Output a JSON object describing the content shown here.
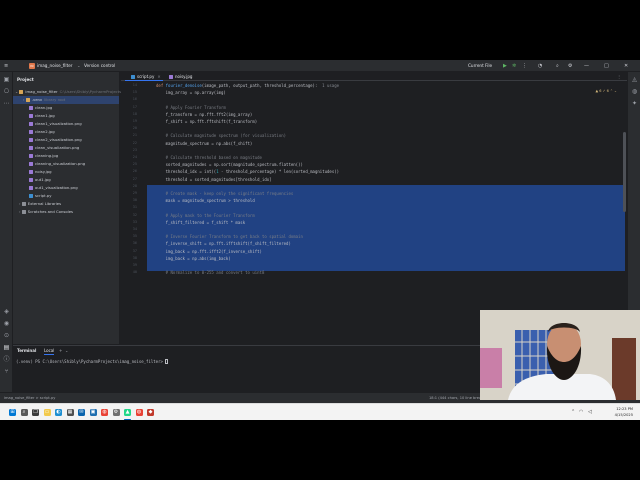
{
  "titlebar": {
    "project_badge": "IN",
    "project_name": "imag_noise_filter",
    "vcs": "Version control",
    "run_config": "Current File",
    "window_controls": [
      "—",
      "□",
      "✕"
    ]
  },
  "project_panel": {
    "header": "Project",
    "root_label": "imag_noise_filter",
    "root_path": "C:\\Users\\Shibly\\PycharmProjects\\imag_noise_filter",
    "items": [
      {
        "label": ".venv",
        "note": "library root",
        "kind": "folder"
      },
      {
        "label": "clean.jpg",
        "kind": "image"
      },
      {
        "label": "clean1.jpg",
        "kind": "image"
      },
      {
        "label": "clean1_visualization.png",
        "kind": "image"
      },
      {
        "label": "clean2.jpg",
        "kind": "image"
      },
      {
        "label": "clean2_visualization.png",
        "kind": "image"
      },
      {
        "label": "clean_visualization.png",
        "kind": "image"
      },
      {
        "label": "cleaning.jpg",
        "kind": "image"
      },
      {
        "label": "cleaning_visualization.png",
        "kind": "image"
      },
      {
        "label": "noisy.jpg",
        "kind": "image"
      },
      {
        "label": "out1.jpg",
        "kind": "image"
      },
      {
        "label": "out1_visualization.png",
        "kind": "image"
      },
      {
        "label": "script.py",
        "kind": "python"
      },
      {
        "label": "External Libraries",
        "kind": "library"
      },
      {
        "label": "Scratches and Consoles",
        "kind": "scratch"
      }
    ]
  },
  "editor": {
    "tabs": [
      {
        "label": "script.py",
        "active": true
      },
      {
        "label": "noisy.jpg",
        "active": false
      }
    ],
    "inspections": "▲ 6  ✓ 6  ⌃ ⌄",
    "line_numbers": [
      "14",
      "15",
      "16",
      "17",
      "18",
      "19",
      "20",
      "21",
      "22",
      "23",
      "24",
      "25",
      "26",
      "27",
      "28",
      "29",
      "30",
      "31",
      "32",
      "33",
      "34",
      "35",
      "36",
      "37",
      "38",
      "39",
      "40"
    ],
    "lines": [
      [
        {
          "t": "def ",
          "c": "kw"
        },
        {
          "t": "fourier_denoise",
          "c": "fn"
        },
        {
          "t": "(image_path, output_path, threshold_percentage):",
          "c": "tx"
        },
        {
          "t": "  1 usage",
          "c": "hint"
        }
      ],
      [
        {
          "t": "    img_array = np.array(img)",
          "c": "tx"
        }
      ],
      [
        {
          "t": "",
          "c": "tx"
        }
      ],
      [
        {
          "t": "    ",
          "c": "tx"
        },
        {
          "t": "# Apply Fourier Transform",
          "c": "cm"
        }
      ],
      [
        {
          "t": "    f_transform = np.fft.fft2(img_array)",
          "c": "tx"
        }
      ],
      [
        {
          "t": "    f_shift = np.fft.fftshift(f_transform)",
          "c": "tx"
        }
      ],
      [
        {
          "t": "",
          "c": "tx"
        }
      ],
      [
        {
          "t": "    ",
          "c": "tx"
        },
        {
          "t": "# Calculate magnitude spectrum (for visualization)",
          "c": "cm"
        }
      ],
      [
        {
          "t": "    magnitude_spectrum = np.abs(f_shift)",
          "c": "tx"
        }
      ],
      [
        {
          "t": "",
          "c": "tx"
        }
      ],
      [
        {
          "t": "    ",
          "c": "tx"
        },
        {
          "t": "# Calculate threshold based on magnitude",
          "c": "cm"
        }
      ],
      [
        {
          "t": "    sorted_magnitudes = np.sort(magnitude_spectrum.flatten())",
          "c": "tx"
        }
      ],
      [
        {
          "t": "    threshold_idx = int((",
          "c": "tx"
        },
        {
          "t": "1",
          "c": "nm"
        },
        {
          "t": " - threshold_percentage) * len(sorted_magnitudes))",
          "c": "tx"
        }
      ],
      [
        {
          "t": "    threshold = sorted_magnitudes[threshold_idx]",
          "c": "tx"
        }
      ],
      [
        {
          "t": "",
          "c": "tx"
        }
      ],
      [
        {
          "t": "    ",
          "c": "tx"
        },
        {
          "t": "# Create mask - keep only the significant frequencies",
          "c": "cm"
        }
      ],
      [
        {
          "t": "    mask = magnitude_spectrum > threshold",
          "c": "tx"
        }
      ],
      [
        {
          "t": "",
          "c": "tx"
        }
      ],
      [
        {
          "t": "    ",
          "c": "tx"
        },
        {
          "t": "# Apply mask to the Fourier Transform",
          "c": "cm"
        }
      ],
      [
        {
          "t": "    f_shift_filtered = f_shift * mask",
          "c": "tx"
        }
      ],
      [
        {
          "t": "",
          "c": "tx"
        }
      ],
      [
        {
          "t": "    ",
          "c": "tx"
        },
        {
          "t": "# Inverse Fourier Transform to get back to spatial domain",
          "c": "cm"
        }
      ],
      [
        {
          "t": "    f_inverse_shift = np.fft.ifftshift(f_shift_filtered)",
          "c": "tx"
        }
      ],
      [
        {
          "t": "    img_back = np.fft.ifft2(f_inverse_shift)",
          "c": "tx"
        }
      ],
      [
        {
          "t": "    img_back = np.abs(img_back)",
          "c": "tx"
        }
      ],
      [
        {
          "t": "",
          "c": "tx"
        }
      ],
      [
        {
          "t": "    ",
          "c": "tx"
        },
        {
          "t": "# Normalize to 0-255 and convert to uint8",
          "c": "cm"
        }
      ]
    ]
  },
  "terminal": {
    "tabs": [
      "Terminal",
      "Local"
    ],
    "prompt": "(.venv) PS C:\\Users\\Shibly\\PycharmProjects\\imag_noise_filter> "
  },
  "statusbar": {
    "breadcrumb": "imag_noise_filter  >  script.py",
    "position": "18:1 (444 chars, 10 line breaks)   CRLF   UTF-8   4 spaces   Python 3.11 (imag_noise_filter)"
  },
  "taskbar": {
    "time": "12:23 PM",
    "date": "4/15/2025",
    "apps": [
      "start",
      "search",
      "taskview",
      "explorer",
      "edge",
      "store",
      "mail",
      "photos",
      "chrome",
      "settings",
      "pycharm",
      "chrome2",
      "app"
    ]
  },
  "colors": {
    "ide_bg": "#1e1f22",
    "panel_bg": "#2b2d30",
    "selection": "#214283",
    "accent": "#3574f0",
    "taskbar": "#f3f3f3"
  }
}
